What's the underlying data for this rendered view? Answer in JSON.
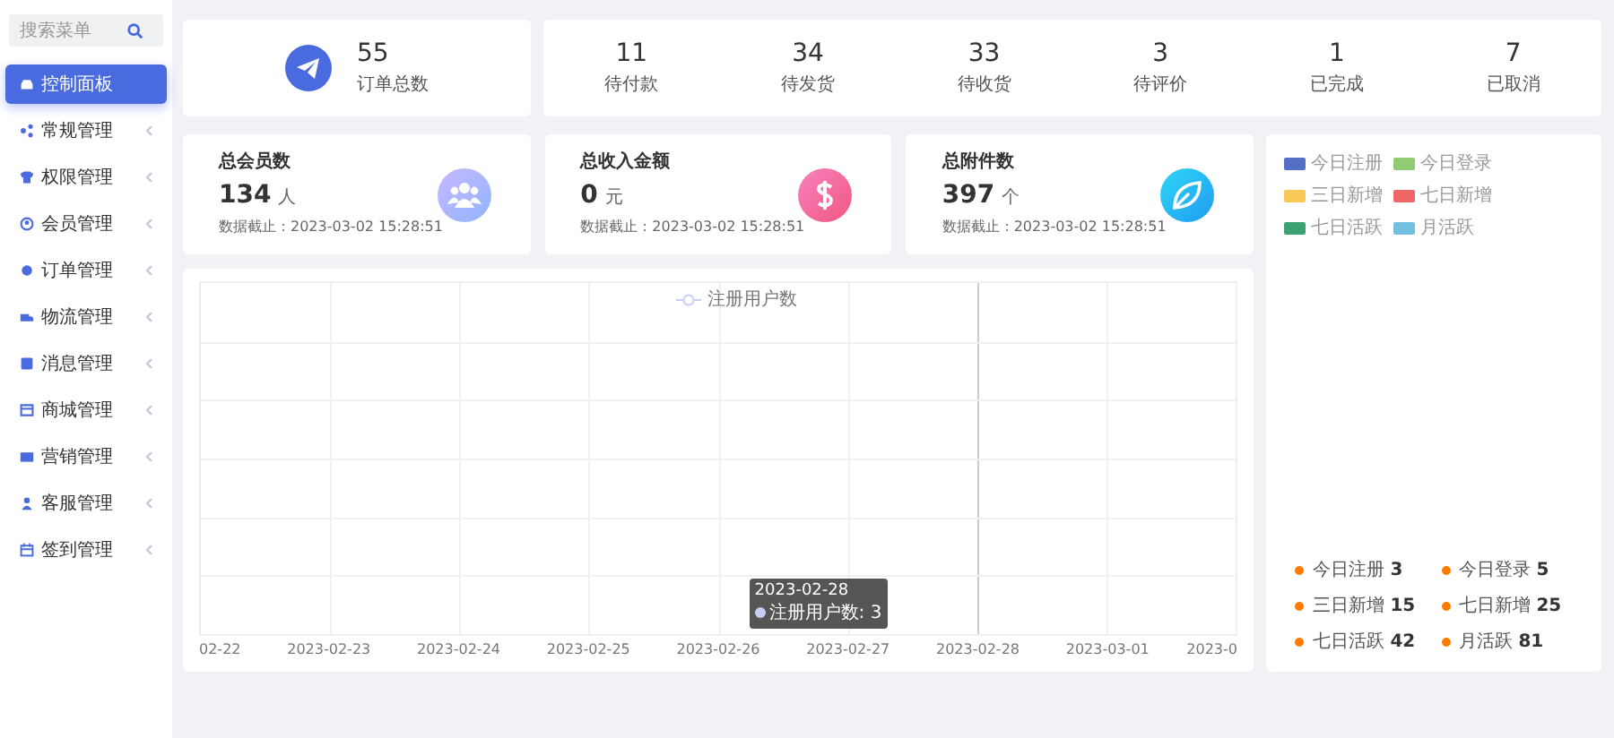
{
  "sidebar": {
    "search": {
      "placeholder": "搜索菜单"
    },
    "items": [
      {
        "label": "控制面板",
        "selected": true
      },
      {
        "label": "常规管理",
        "selected": false
      },
      {
        "label": "权限管理",
        "selected": false
      },
      {
        "label": "会员管理",
        "selected": false
      },
      {
        "label": "订单管理",
        "selected": false
      },
      {
        "label": "物流管理",
        "selected": false
      },
      {
        "label": "消息管理",
        "selected": false
      },
      {
        "label": "商城管理",
        "selected": false
      },
      {
        "label": "营销管理",
        "selected": false
      },
      {
        "label": "客服管理",
        "selected": false
      },
      {
        "label": "签到管理",
        "selected": false
      }
    ]
  },
  "order_total": {
    "value": "55",
    "label": "订单总数"
  },
  "order_stats": [
    {
      "value": "11",
      "label": "待付款"
    },
    {
      "value": "34",
      "label": "待发货"
    },
    {
      "value": "33",
      "label": "待收货"
    },
    {
      "value": "3",
      "label": "待评价"
    },
    {
      "value": "1",
      "label": "已完成"
    },
    {
      "value": "7",
      "label": "已取消"
    }
  ],
  "summary_cards": [
    {
      "title": "总会员数",
      "value": "134",
      "unit": "人",
      "date": "数据截止：2023-03-02 15:28:51"
    },
    {
      "title": "总收入金额",
      "value": "0",
      "unit": "元",
      "date": "数据截止：2023-03-02 15:28:51"
    },
    {
      "title": "总附件数",
      "value": "397",
      "unit": "个",
      "date": "数据截止：2023-03-02 15:28:51"
    }
  ],
  "chart": {
    "legend": "注册用户数",
    "x_labels": [
      "02-22",
      "2023-02-23",
      "2023-02-24",
      "2023-02-25",
      "2023-02-26",
      "2023-02-27",
      "2023-02-28",
      "2023-03-01",
      "2023-0"
    ],
    "tooltip": {
      "title": "2023-02-28",
      "text": "注册用户数: 3"
    }
  },
  "pie_legend": [
    {
      "label": "今日注册",
      "color": "#5470c6"
    },
    {
      "label": "今日登录",
      "color": "#91cc75"
    },
    {
      "label": "三日新增",
      "color": "#fac858"
    },
    {
      "label": "七日新增",
      "color": "#ee6666"
    },
    {
      "label": "七日活跃",
      "color": "#3ba272"
    },
    {
      "label": "月活跃",
      "color": "#73c0de"
    }
  ],
  "user_stats": [
    {
      "label": "今日注册",
      "value": "3"
    },
    {
      "label": "今日登录",
      "value": "5"
    },
    {
      "label": "三日新增",
      "value": "15"
    },
    {
      "label": "七日新增",
      "value": "25"
    },
    {
      "label": "七日活跃",
      "value": "42"
    },
    {
      "label": "月活跃",
      "value": "81"
    }
  ]
}
